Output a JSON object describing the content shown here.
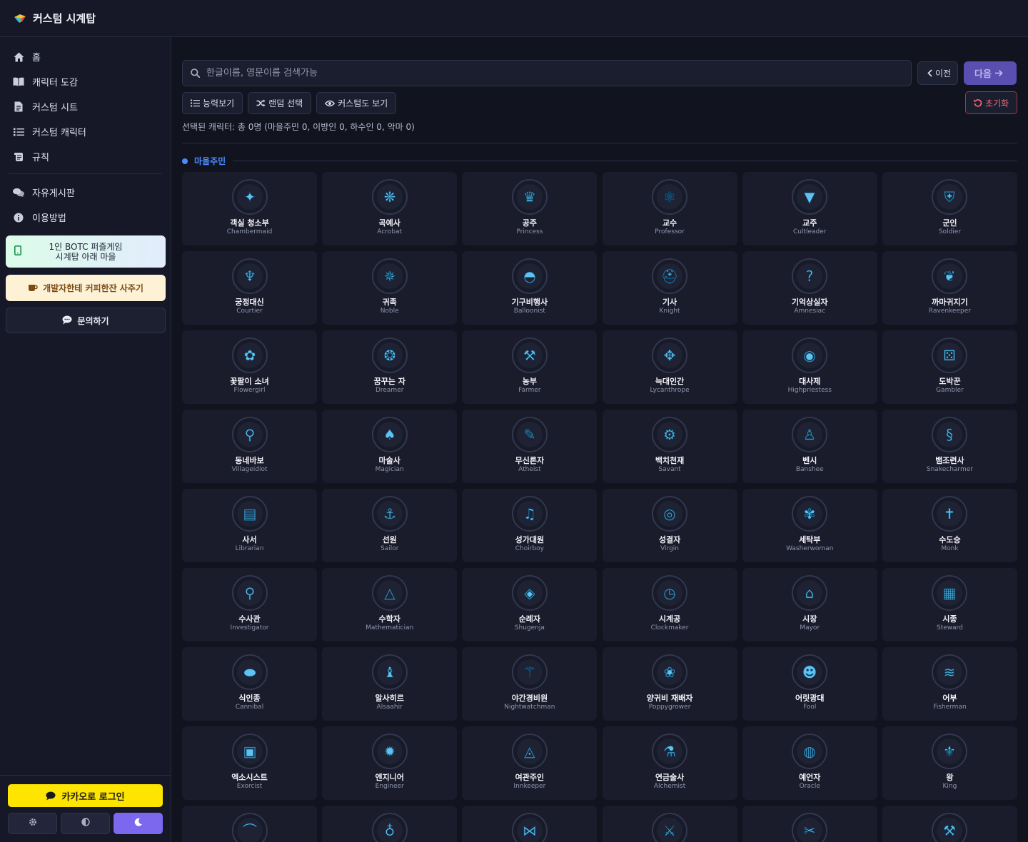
{
  "app": {
    "title": "커스텀 시계탑"
  },
  "sidebar": {
    "items": [
      {
        "label": "홈",
        "icon": "home-icon"
      },
      {
        "label": "캐릭터 도감",
        "icon": "book-icon"
      },
      {
        "label": "커스텀 시트",
        "icon": "file-icon"
      },
      {
        "label": "커스텀 캐릭터",
        "icon": "list-icon"
      },
      {
        "label": "규칙",
        "icon": "scroll-icon"
      },
      {
        "label": "자유게시판",
        "icon": "comments-icon"
      },
      {
        "label": "이용방법",
        "icon": "info-icon"
      }
    ],
    "promo_botc_line1": "1인 BOTC 퍼즐게임",
    "promo_botc_line2": "시계탑 아래 마을",
    "promo_coffee": "개발자한테 커피한잔 사주기",
    "promo_ask": "문의하기",
    "kakao_login": "카카오로 로그인",
    "theme_active": "dark"
  },
  "search": {
    "placeholder": "한글이름, 영문이름 검색가능",
    "value": ""
  },
  "nav_buttons": {
    "prev": "이전",
    "next": "다음"
  },
  "toolbar": {
    "abilities": "능력보기",
    "random": "랜덤 선택",
    "custom_view": "커스텀도 보기",
    "reset": "초기화"
  },
  "selection_info": "선택된 캐릭터: 총 0명 (마을주민 0, 이방인 0, 하수인 0, 악마 0)",
  "section": {
    "title": "마을주민",
    "accent": "#4a8cff"
  },
  "colors": {
    "accent": "#7b68ee",
    "kakao": "#fee500",
    "danger": "#ff6b78",
    "token_blue": "#4fb3e8"
  },
  "characters": [
    {
      "ko": "객실 청소부",
      "en": "Chambermaid",
      "icon": "broom-icon"
    },
    {
      "ko": "곡예사",
      "en": "Acrobat",
      "icon": "garland-icon"
    },
    {
      "ko": "공주",
      "en": "Princess",
      "icon": "tiara-icon"
    },
    {
      "ko": "교수",
      "en": "Professor",
      "icon": "atom-icon"
    },
    {
      "ko": "교주",
      "en": "Cultleader",
      "icon": "triangle-icon"
    },
    {
      "ko": "군인",
      "en": "Soldier",
      "icon": "shield-icon"
    },
    {
      "ko": "궁정대신",
      "en": "Courtier",
      "icon": "goblet-icon"
    },
    {
      "ko": "귀족",
      "en": "Noble",
      "icon": "crest-icon"
    },
    {
      "ko": "기구비행사",
      "en": "Balloonist",
      "icon": "balloon-icon"
    },
    {
      "ko": "기사",
      "en": "Knight",
      "icon": "helmet-icon"
    },
    {
      "ko": "기억상실자",
      "en": "Amnesiac",
      "icon": "question-icon"
    },
    {
      "ko": "까마귀지기",
      "en": "Ravenkeeper",
      "icon": "raven-icon"
    },
    {
      "ko": "꽃팔이 소녀",
      "en": "Flowergirl",
      "icon": "flower-icon"
    },
    {
      "ko": "꿈꾸는 자",
      "en": "Dreamer",
      "icon": "dreamcatcher-icon"
    },
    {
      "ko": "농부",
      "en": "Farmer",
      "icon": "pitchfork-icon"
    },
    {
      "ko": "늑대인간",
      "en": "Lycanthrope",
      "icon": "paw-icon"
    },
    {
      "ko": "대사제",
      "en": "Highpriestess",
      "icon": "eye-icon"
    },
    {
      "ko": "도박꾼",
      "en": "Gambler",
      "icon": "dice-icon"
    },
    {
      "ko": "동네바보",
      "en": "Villageidiot",
      "icon": "rattle-icon"
    },
    {
      "ko": "마술사",
      "en": "Magician",
      "icon": "hat-icon"
    },
    {
      "ko": "무신론자",
      "en": "Atheist",
      "icon": "feather-icon"
    },
    {
      "ko": "백치천재",
      "en": "Savant",
      "icon": "gears-icon"
    },
    {
      "ko": "벤시",
      "en": "Banshee",
      "icon": "figure-icon"
    },
    {
      "ko": "뱀조련사",
      "en": "Snakecharmer",
      "icon": "snake-icon"
    },
    {
      "ko": "사서",
      "en": "Librarian",
      "icon": "book-icon"
    },
    {
      "ko": "선원",
      "en": "Sailor",
      "icon": "anchor-icon"
    },
    {
      "ko": "성가대원",
      "en": "Choirboy",
      "icon": "music-icon"
    },
    {
      "ko": "성결자",
      "en": "Virgin",
      "icon": "ring-icon"
    },
    {
      "ko": "세탁부",
      "en": "Washerwoman",
      "icon": "laundry-icon"
    },
    {
      "ko": "수도승",
      "en": "Monk",
      "icon": "monk-icon"
    },
    {
      "ko": "수사관",
      "en": "Investigator",
      "icon": "magnifier-icon"
    },
    {
      "ko": "수학자",
      "en": "Mathematician",
      "icon": "pyramid-icon"
    },
    {
      "ko": "순례자",
      "en": "Shugenja",
      "icon": "bag-icon"
    },
    {
      "ko": "시계공",
      "en": "Clockmaker",
      "icon": "clock-icon"
    },
    {
      "ko": "시장",
      "en": "Mayor",
      "icon": "townhall-icon"
    },
    {
      "ko": "시종",
      "en": "Steward",
      "icon": "map-icon"
    },
    {
      "ko": "식인종",
      "en": "Cannibal",
      "icon": "cake-icon"
    },
    {
      "ko": "알사히르",
      "en": "Alsaahir",
      "icon": "candle-icon"
    },
    {
      "ko": "야간경비원",
      "en": "Nightwatchman",
      "icon": "lamppost-icon"
    },
    {
      "ko": "양귀비 재배자",
      "en": "Poppygrower",
      "icon": "poppy-icon"
    },
    {
      "ko": "어릿광대",
      "en": "Fool",
      "icon": "jester-icon"
    },
    {
      "ko": "어부",
      "en": "Fisherman",
      "icon": "fish-icon"
    },
    {
      "ko": "엑소시스트",
      "en": "Exorcist",
      "icon": "case-icon"
    },
    {
      "ko": "엔지니어",
      "en": "Engineer",
      "icon": "gear-icon"
    },
    {
      "ko": "여관주인",
      "en": "Innkeeper",
      "icon": "sign-icon"
    },
    {
      "ko": "연금술사",
      "en": "Alchemist",
      "icon": "potion-icon"
    },
    {
      "ko": "예언자",
      "en": "Oracle",
      "icon": "all-seeing-eye-icon"
    },
    {
      "ko": "왕",
      "en": "King",
      "icon": "fleur-de-lis-icon"
    },
    {
      "ko": "",
      "en": "",
      "icon": "chef-hat-icon"
    },
    {
      "ko": "",
      "en": "",
      "icon": "lyre-icon"
    },
    {
      "ko": "",
      "en": "",
      "icon": "wings-icon"
    },
    {
      "ko": "",
      "en": "",
      "icon": "shovel-icon"
    },
    {
      "ko": "",
      "en": "",
      "icon": "scissors-icon"
    },
    {
      "ko": "",
      "en": "",
      "icon": "tools-icon"
    }
  ]
}
